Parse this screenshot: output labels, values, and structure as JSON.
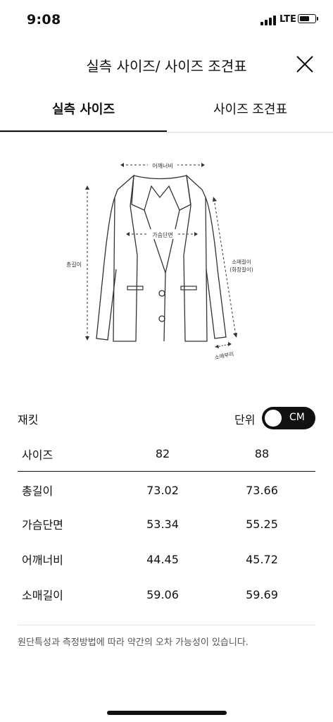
{
  "status_bar": {
    "time": "9:08",
    "carrier": "LTE",
    "battery_fill": 0.7
  },
  "header": {
    "title": "실측 사이즈/ 사이즈 조견표",
    "close_icon": "close-icon"
  },
  "tabs": [
    {
      "label": "실측 사이즈",
      "active": true
    },
    {
      "label": "사이즈 조견표",
      "active": false
    }
  ],
  "diagram": {
    "shoulder_label": "어깨너비",
    "chest_label": "가슴단면",
    "length_label": "총길이",
    "sleeve_label_1": "소매길이",
    "sleeve_label_2": "(화장길이)",
    "cuff_label": "소매부리"
  },
  "product": {
    "name": "재킷",
    "unit_label": "단위",
    "unit_value": "CM"
  },
  "size_table": {
    "headers": [
      "사이즈",
      "82",
      "88"
    ],
    "rows": [
      [
        "총길이",
        "73.02",
        "73.66"
      ],
      [
        "가슴단면",
        "53.34",
        "55.25"
      ],
      [
        "어깨너비",
        "44.45",
        "45.72"
      ],
      [
        "소매길이",
        "59.06",
        "59.69"
      ]
    ]
  },
  "footnote": "원단특성과 측정방법에 따라 약간의 오차 가능성이 있습니다."
}
